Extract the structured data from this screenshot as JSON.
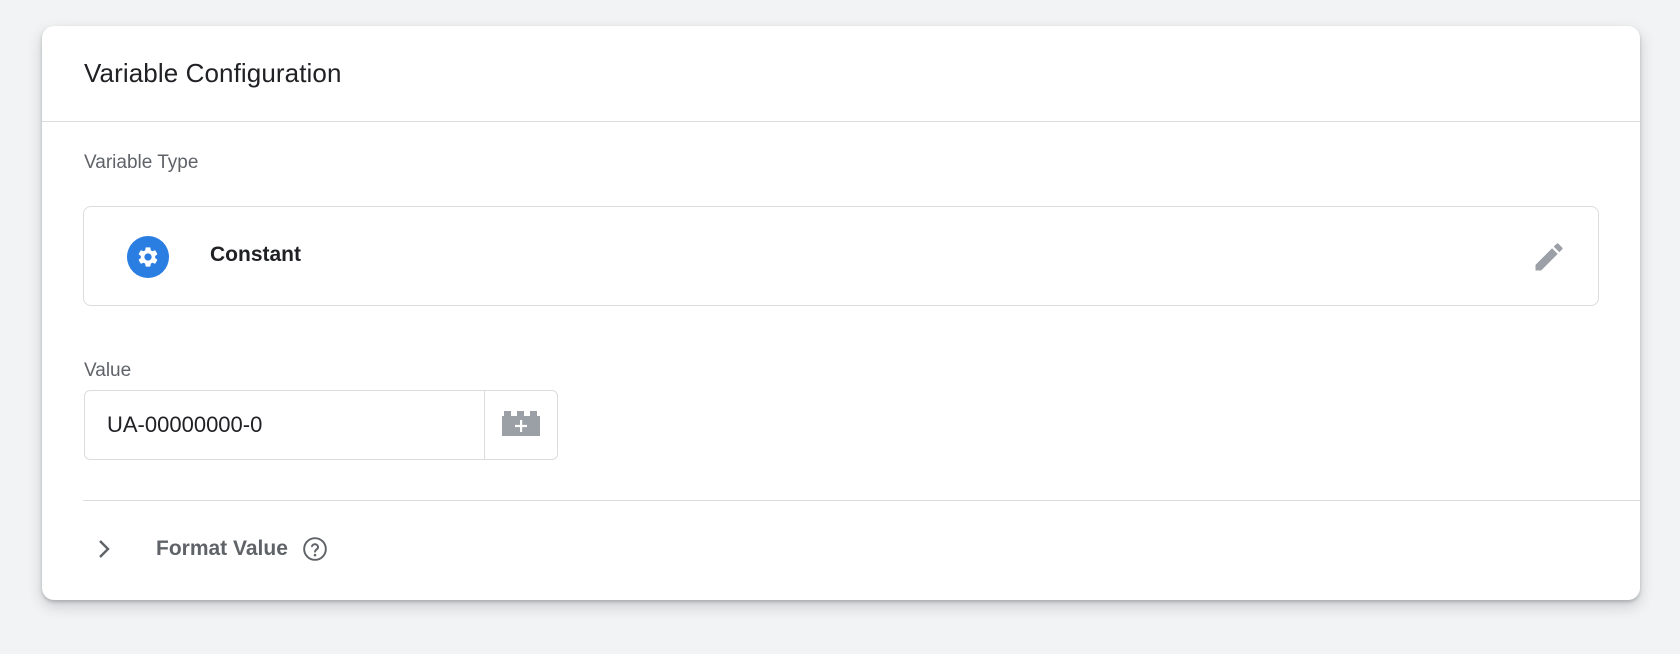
{
  "card": {
    "title": "Variable Configuration"
  },
  "variable_type": {
    "label": "Variable Type",
    "name": "Constant",
    "icon": "gear-icon",
    "edit_icon": "pencil-icon",
    "icon_color": "#2a7de1"
  },
  "value": {
    "label": "Value",
    "current_value": "UA-00000000-0",
    "picker_icon": "add-variable-brick-icon"
  },
  "format_value": {
    "label": "Format Value",
    "expand_icon": "chevron-right-icon",
    "help_icon": "help-circle-icon"
  }
}
